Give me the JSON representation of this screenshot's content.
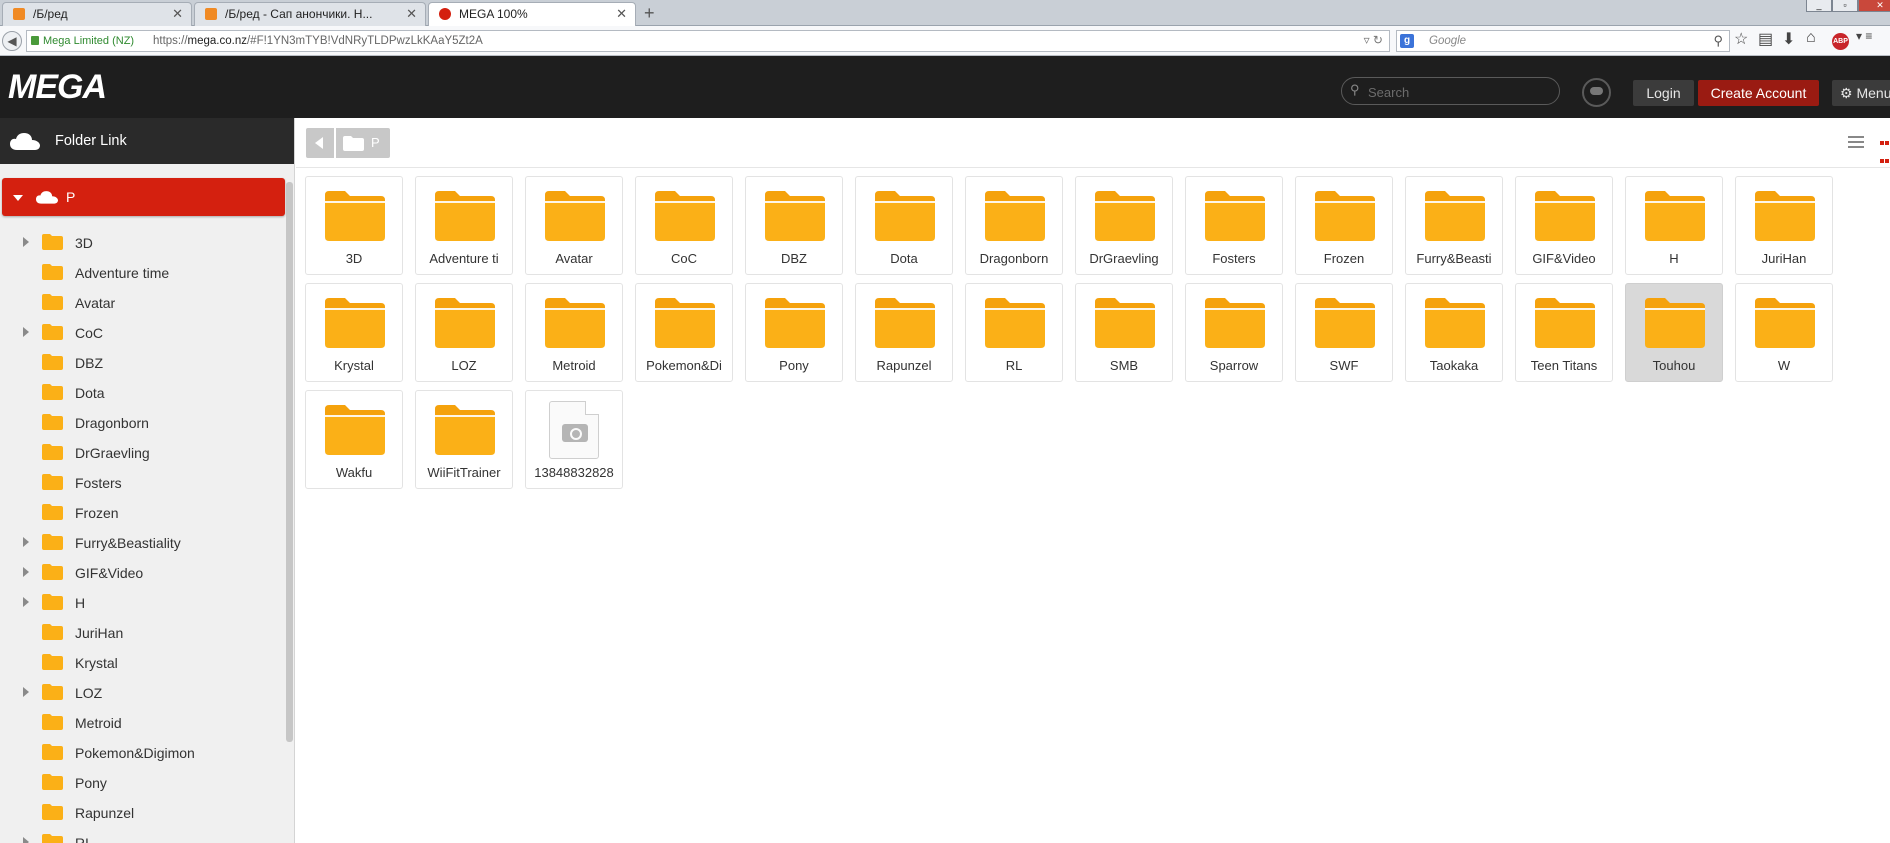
{
  "browser": {
    "tabs": [
      {
        "title": "/Б/ред",
        "active": false
      },
      {
        "title": "/Б/ред - Сап анончики. Н...",
        "active": false
      },
      {
        "title": "MEGA 100%",
        "active": true
      }
    ],
    "ssl_label": "Mega Limited (NZ)",
    "url_prefix": "https://",
    "url_host": "mega.co.nz",
    "url_path": "/#F!1YN3mTYB!VdNRyTLDPwzLkKAaY5Zt2A",
    "search_engine_placeholder": "Google",
    "abp_label": "ABP"
  },
  "header": {
    "logo": "MEGA",
    "search_placeholder": "Search",
    "login_label": "Login",
    "create_account_label": "Create Account",
    "menu_label": "Menu"
  },
  "sidebar": {
    "title": "Folder Link",
    "root": "P",
    "items": [
      {
        "name": "3D",
        "expandable": true
      },
      {
        "name": "Adventure time",
        "expandable": false
      },
      {
        "name": "Avatar",
        "expandable": false
      },
      {
        "name": "CoC",
        "expandable": true
      },
      {
        "name": "DBZ",
        "expandable": false
      },
      {
        "name": "Dota",
        "expandable": false
      },
      {
        "name": "Dragonborn",
        "expandable": false
      },
      {
        "name": "DrGraevling",
        "expandable": false
      },
      {
        "name": "Fosters",
        "expandable": false
      },
      {
        "name": "Frozen",
        "expandable": false
      },
      {
        "name": "Furry&Beastiality",
        "expandable": true
      },
      {
        "name": "GIF&Video",
        "expandable": true
      },
      {
        "name": "H",
        "expandable": true
      },
      {
        "name": "JuriHan",
        "expandable": false
      },
      {
        "name": "Krystal",
        "expandable": false
      },
      {
        "name": "LOZ",
        "expandable": true
      },
      {
        "name": "Metroid",
        "expandable": false
      },
      {
        "name": "Pokemon&Digimon",
        "expandable": false
      },
      {
        "name": "Pony",
        "expandable": false
      },
      {
        "name": "Rapunzel",
        "expandable": false
      },
      {
        "name": "RL",
        "expandable": true
      }
    ]
  },
  "main": {
    "breadcrumb": "P",
    "tiles": [
      {
        "label": "3D",
        "type": "folder",
        "selected": false
      },
      {
        "label": "Adventure ti",
        "type": "folder",
        "selected": false
      },
      {
        "label": "Avatar",
        "type": "folder",
        "selected": false
      },
      {
        "label": "CoC",
        "type": "folder",
        "selected": false
      },
      {
        "label": "DBZ",
        "type": "folder",
        "selected": false
      },
      {
        "label": "Dota",
        "type": "folder",
        "selected": false
      },
      {
        "label": "Dragonborn",
        "type": "folder",
        "selected": false
      },
      {
        "label": "DrGraevling",
        "type": "folder",
        "selected": false
      },
      {
        "label": "Fosters",
        "type": "folder",
        "selected": false
      },
      {
        "label": "Frozen",
        "type": "folder",
        "selected": false
      },
      {
        "label": "Furry&Beasti",
        "type": "folder",
        "selected": false
      },
      {
        "label": "GIF&Video",
        "type": "folder",
        "selected": false
      },
      {
        "label": "H",
        "type": "folder",
        "selected": false
      },
      {
        "label": "JuriHan",
        "type": "folder",
        "selected": false
      },
      {
        "label": "Krystal",
        "type": "folder",
        "selected": false
      },
      {
        "label": "LOZ",
        "type": "folder",
        "selected": false
      },
      {
        "label": "Metroid",
        "type": "folder",
        "selected": false
      },
      {
        "label": "Pokemon&Di",
        "type": "folder",
        "selected": false
      },
      {
        "label": "Pony",
        "type": "folder",
        "selected": false
      },
      {
        "label": "Rapunzel",
        "type": "folder",
        "selected": false
      },
      {
        "label": "RL",
        "type": "folder",
        "selected": false
      },
      {
        "label": "SMB",
        "type": "folder",
        "selected": false
      },
      {
        "label": "Sparrow",
        "type": "folder",
        "selected": false
      },
      {
        "label": "SWF",
        "type": "folder",
        "selected": false
      },
      {
        "label": "Taokaka",
        "type": "folder",
        "selected": false
      },
      {
        "label": "Teen Titans",
        "type": "folder",
        "selected": false
      },
      {
        "label": "Touhou",
        "type": "folder",
        "selected": true
      },
      {
        "label": "W",
        "type": "folder",
        "selected": false
      },
      {
        "label": "Wakfu",
        "type": "folder",
        "selected": false
      },
      {
        "label": "WiiFitTrainer",
        "type": "folder",
        "selected": false
      },
      {
        "label": "13848832828",
        "type": "image",
        "selected": false
      }
    ]
  },
  "colors": {
    "accent": "#d4200f",
    "folder": "#fbb017",
    "folder_tab": "#f5a20c",
    "header_bg": "#1e1e1e",
    "create_account": "#9a1b12"
  }
}
